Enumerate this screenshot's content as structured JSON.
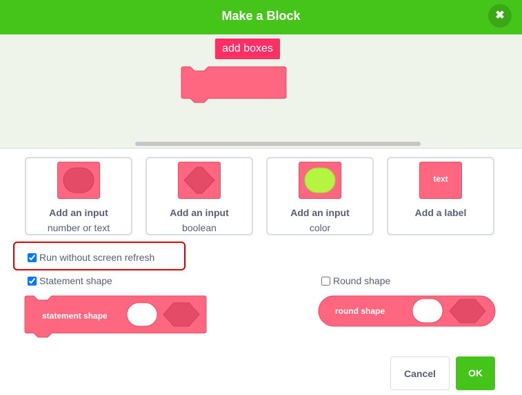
{
  "dialog": {
    "title": "Make a Block",
    "close_icon": "close-icon"
  },
  "preview": {
    "block_name": "add boxes"
  },
  "options": [
    {
      "title": "Add an input",
      "subtitle": "number or text",
      "icon": "number-text-input-icon"
    },
    {
      "title": "Add an input",
      "subtitle": "boolean",
      "icon": "boolean-input-icon"
    },
    {
      "title": "Add an input",
      "subtitle": "color",
      "icon": "color-input-icon"
    },
    {
      "title": "Add a label",
      "subtitle": "",
      "icon": "label-icon",
      "icon_text": "text"
    }
  ],
  "checkboxes": {
    "run_without_refresh": {
      "label": "Run without screen refresh",
      "checked": true
    },
    "statement_shape": {
      "label": "Statement shape",
      "checked": true
    },
    "round_shape": {
      "label": "Round shape",
      "checked": false
    }
  },
  "shapes": {
    "statement": {
      "label": "statement shape"
    },
    "round": {
      "label": "round shape"
    }
  },
  "buttons": {
    "cancel": "Cancel",
    "ok": "OK"
  },
  "colors": {
    "header": "#45c51a",
    "block": "#ff6680",
    "block_border": "#e3505f",
    "name_field": "#ff2f66",
    "color_input": "#b5f542",
    "highlight": "#e00000"
  }
}
